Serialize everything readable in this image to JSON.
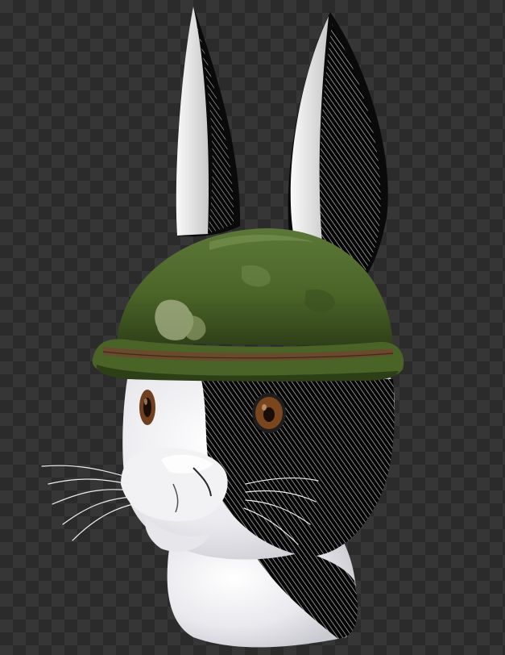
{
  "scene": {
    "subject": "bunny-head-with-helmet"
  },
  "colors": {
    "checker_dark": "#2b2b2b",
    "checker_light": "#363636",
    "fur_white": "#f4f4f6",
    "fur_shadow": "#0a0a0a",
    "helmet_green": "#4f6a30",
    "helmet_dark": "#2f4219",
    "helmet_strap": "#6a4a2c",
    "eye_iris": "#6f4020",
    "eye_pupil": "#1a0d06"
  },
  "icons": {
    "background": "checkerboard-transparency-icon"
  }
}
